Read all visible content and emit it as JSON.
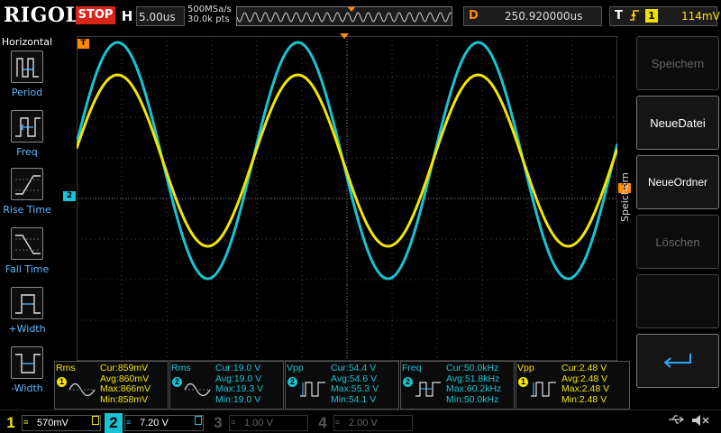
{
  "top": {
    "logo": "RIGOL",
    "run_status": "STOP",
    "h_label": "H",
    "timebase": "5.00us",
    "sample_rate": "500MSa/s",
    "mem_depth": "30.0k pts",
    "delay_label": "D",
    "delay_value": "250.920000us",
    "trig_label": "T",
    "trig_edge_icon": "rising-edge-icon",
    "trig_source": "1",
    "trig_level": "114mV"
  },
  "left_menu": {
    "title": "Horizontal",
    "items": [
      {
        "label": "Period",
        "icon": "period-icon"
      },
      {
        "label": "Freq",
        "icon": "frequency-icon"
      },
      {
        "label": "Rise Time",
        "icon": "rise-time-icon"
      },
      {
        "label": "Fall Time",
        "icon": "fall-time-icon"
      },
      {
        "label": "+Width",
        "icon": "positive-width-icon"
      },
      {
        "label": "-Width",
        "icon": "negative-width-icon"
      }
    ]
  },
  "right_menu": {
    "title": "Speichern",
    "items": [
      {
        "label": "Speichern",
        "enabled": false
      },
      {
        "label": "NeueDatei",
        "enabled": true
      },
      {
        "label": "NeueOrdner",
        "enabled": true
      },
      {
        "label": "Löschen",
        "enabled": false
      },
      {
        "label": "",
        "icon": "enter-return-icon",
        "enabled": true
      }
    ]
  },
  "markers": {
    "trigger_top": "T",
    "ch2_level": "2",
    "trigger_right": "T"
  },
  "measurements": [
    {
      "name": "Rms",
      "channel": "1",
      "channel_color": "#f2e600",
      "cur": "Cur:859mV",
      "avg": "Avg:860mV",
      "max": "Max:866mV",
      "min": "Min:858mV"
    },
    {
      "name": "Rms",
      "channel": "2",
      "channel_color": "#19c3d3",
      "cur": "Cur:19.0 V",
      "avg": "Avg:19.0 V",
      "max": "Max:19.3 V",
      "min": "Min:19.0 V"
    },
    {
      "name": "Vpp",
      "channel": "2",
      "channel_color": "#19c3d3",
      "cur": "Cur:54.4 V",
      "avg": "Avg:54.6 V",
      "max": "Max:55.3 V",
      "min": "Min:54.1 V"
    },
    {
      "name": "Freq",
      "channel": "2",
      "channel_color": "#19c3d3",
      "cur": "Cur:50.0kHz",
      "avg": "Avg:51.8kHz",
      "max": "Max:60.2kHz",
      "min": "Min:50.0kHz"
    },
    {
      "name": "Vpp",
      "channel": "1",
      "channel_color": "#f2e600",
      "cur": "Cur:2.48 V",
      "avg": "Avg:2.48 V",
      "max": "Max:2.48 V",
      "min": "Min:2.48 V"
    }
  ],
  "channels": [
    {
      "num": "1",
      "scale": "570mV",
      "color": "#f2e600",
      "active": true
    },
    {
      "num": "2",
      "scale": "7.20 V",
      "color": "#19c3d3",
      "active": true
    },
    {
      "num": "3",
      "scale": "1.00 V",
      "color": "#c040c0",
      "active": false
    },
    {
      "num": "4",
      "scale": "2.00 V",
      "color": "#2a6ad8",
      "active": false
    }
  ],
  "status": {
    "usb_icon": "usb-icon",
    "mute_icon": "speaker-mute-icon"
  },
  "waveforms": {
    "ch1_color": "#f2e600",
    "ch2_color": "#19c3d3"
  }
}
